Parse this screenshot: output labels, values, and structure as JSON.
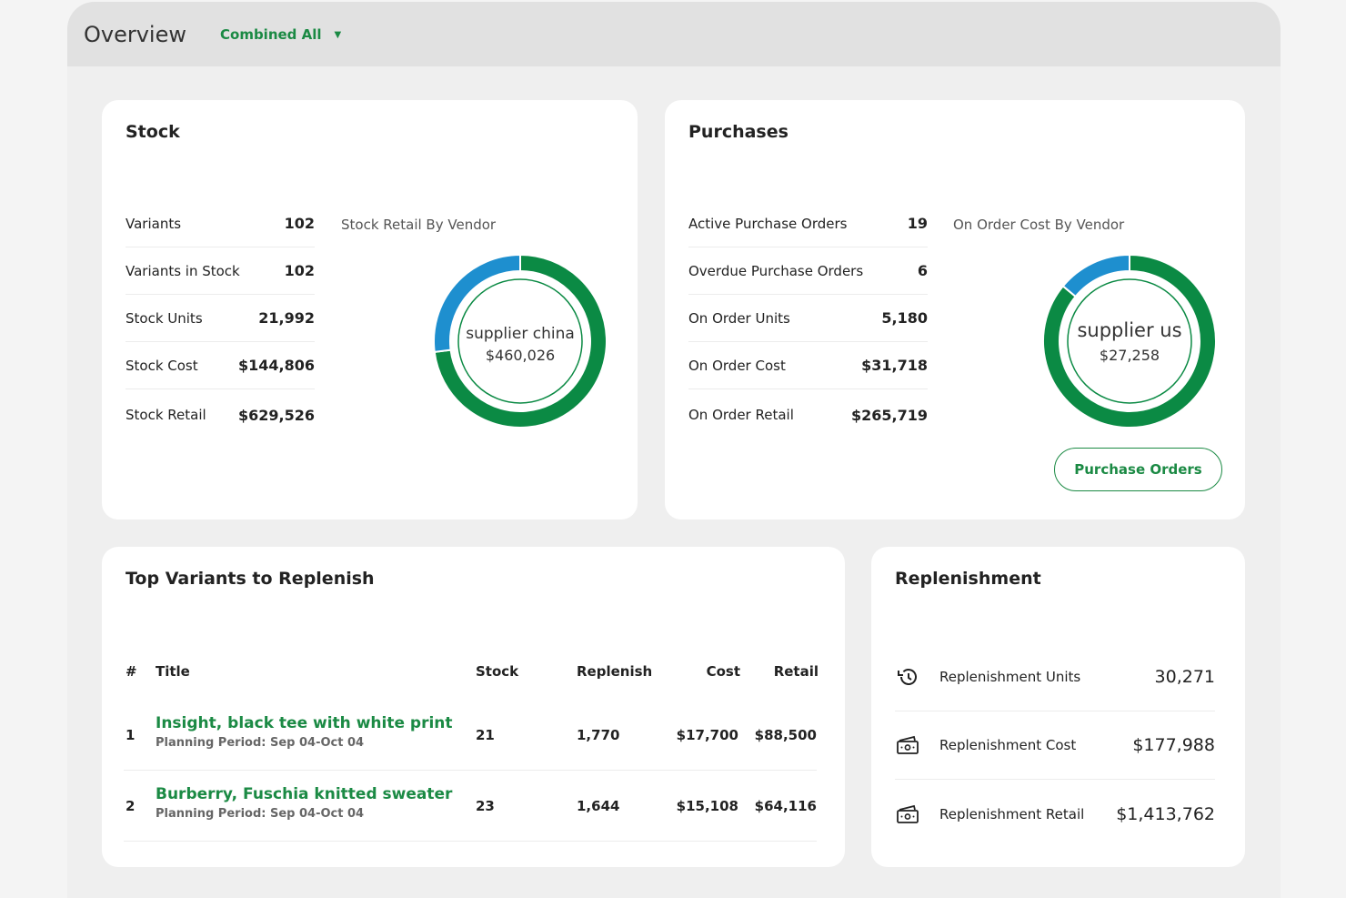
{
  "header": {
    "title": "Overview",
    "scope_selector": "Combined All"
  },
  "stock": {
    "title": "Stock",
    "stats": [
      {
        "label": "Variants",
        "value": "102"
      },
      {
        "label": "Variants in Stock",
        "value": "102"
      },
      {
        "label": "Stock Units",
        "value": "21,992"
      },
      {
        "label": "Stock Cost",
        "value": "$144,806"
      },
      {
        "label": "Stock Retail",
        "value": "$629,526"
      }
    ],
    "chart": {
      "label": "Stock Retail By Vendor",
      "center_name": "supplier china",
      "center_value": "$460,026",
      "segments": [
        {
          "share": 0.73,
          "color": "#0b8a44"
        },
        {
          "share": 0.27,
          "color": "#1e8fcf"
        }
      ]
    }
  },
  "purchases": {
    "title": "Purchases",
    "stats": [
      {
        "label": "Active Purchase Orders",
        "value": "19"
      },
      {
        "label": "Overdue Purchase Orders",
        "value": "6"
      },
      {
        "label": "On Order Units",
        "value": "5,180"
      },
      {
        "label": "On Order Cost",
        "value": "$31,718"
      },
      {
        "label": "On Order Retail",
        "value": "$265,719"
      }
    ],
    "chart": {
      "label": "On Order Cost By Vendor",
      "center_name": "supplier us",
      "center_value": "$27,258",
      "segments": [
        {
          "share": 0.86,
          "color": "#0b8a44"
        },
        {
          "share": 0.14,
          "color": "#1e8fcf"
        }
      ]
    },
    "button": "Purchase Orders"
  },
  "top_variants": {
    "title": "Top Variants to Replenish",
    "columns": [
      "#",
      "Title",
      "Stock",
      "Replenish",
      "Cost",
      "Retail"
    ],
    "rows": [
      {
        "num": "1",
        "title": "Insight, black tee with white print",
        "period": "Planning Period: Sep 04-Oct 04",
        "stock": "21",
        "replenish": "1,770",
        "cost": "$17,700",
        "retail": "$88,500"
      },
      {
        "num": "2",
        "title": "Burberry, Fuschia knitted sweater",
        "period": "Planning Period: Sep 04-Oct 04",
        "stock": "23",
        "replenish": "1,644",
        "cost": "$15,108",
        "retail": "$64,116"
      }
    ]
  },
  "replenishment": {
    "title": "Replenishment",
    "rows": [
      {
        "icon": "history-icon",
        "label": "Replenishment Units",
        "value": "30,271"
      },
      {
        "icon": "cash-icon",
        "label": "Replenishment Cost",
        "value": "$177,988"
      },
      {
        "icon": "cash-icon",
        "label": "Replenishment Retail",
        "value": "$1,413,762"
      }
    ]
  }
}
